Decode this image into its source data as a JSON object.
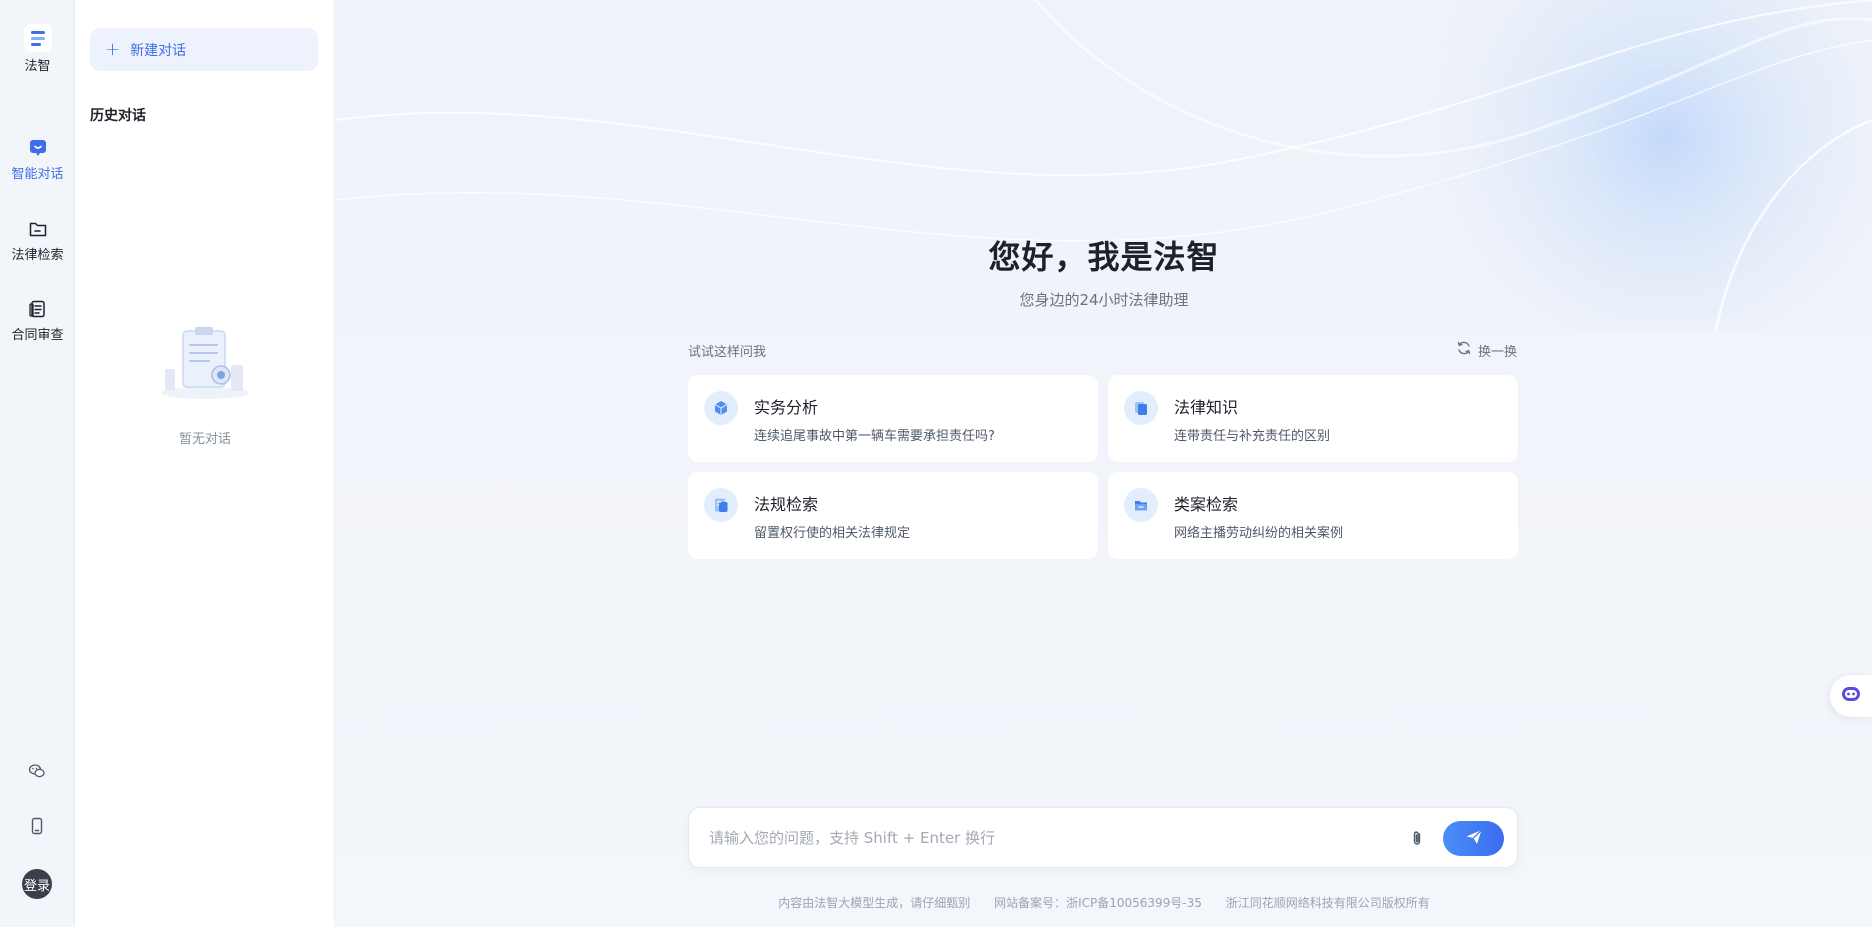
{
  "rail": {
    "logo_text": "法智",
    "items": [
      {
        "label": "智能对话",
        "icon": "chat-bubble-icon",
        "active": true
      },
      {
        "label": "法律检索",
        "icon": "folder-search-icon",
        "active": false
      },
      {
        "label": "合同审查",
        "icon": "document-review-icon",
        "active": false
      }
    ],
    "bottom_icons": [
      "wechat-icon",
      "mobile-phone-icon"
    ],
    "login_label": "登录"
  },
  "sidebar": {
    "new_chat_label": "新建对话",
    "history_title": "历史对话",
    "empty_text": "暂无对话"
  },
  "main": {
    "greeting": "您好，我是法智",
    "subtitle": "您身边的24小时法律助理",
    "try_label": "试试这样问我",
    "refresh_label": "换一换",
    "cards": [
      {
        "title": "实务分析",
        "desc": "连续追尾事故中第一辆车需要承担责任吗?",
        "icon": "cube-icon"
      },
      {
        "title": "法律知识",
        "desc": "连带责任与补充责任的区别",
        "icon": "book-icon"
      },
      {
        "title": "法规检索",
        "desc": "留置权行使的相关法律规定",
        "icon": "document-search-icon"
      },
      {
        "title": "类案检索",
        "desc": "网络主播劳动纠纷的相关案例",
        "icon": "folder-icon"
      }
    ],
    "input": {
      "placeholder": "请输入您的问题，支持 Shift + Enter 换行",
      "value": ""
    },
    "footer": {
      "disclaimer": "内容由法智大模型生成，请仔细甄别",
      "icp": "网站备案号：浙ICP备10056399号-35",
      "copyright": "浙江同花顺网络科技有限公司版权所有"
    }
  },
  "colors": {
    "accent": "#3e6fe8",
    "send_start": "#4b8ef7",
    "send_end": "#3a6cf0",
    "background": "#f3f6fb"
  }
}
